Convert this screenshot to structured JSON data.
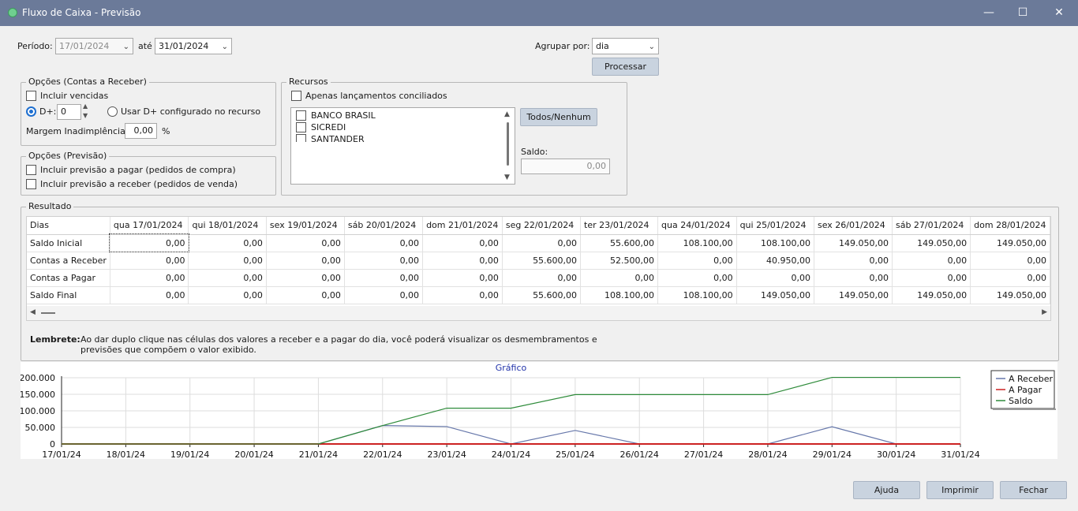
{
  "window": {
    "title": "Fluxo de Caixa - Previsão",
    "minimize": "—",
    "maximize": "☐",
    "close": "✕"
  },
  "periodo": {
    "label": "Período:",
    "from": "17/01/2024",
    "ate_label": "até",
    "to": "31/01/2024"
  },
  "agrupar": {
    "label": "Agrupar por:",
    "value": "dia"
  },
  "processar_label": "Processar",
  "opcoes_receber": {
    "title": "Opções (Contas a Receber)",
    "incluir_vencidas": "Incluir vencidas",
    "dplus_label": "D+:",
    "dplus_value": "0",
    "usar_dplus": "Usar D+ configurado no recurso",
    "margem_label": "Margem Inadimplência:",
    "margem_value": "0,00",
    "margem_unit": "%"
  },
  "opcoes_previsao": {
    "title": "Opções (Previsão)",
    "pagar": "Incluir previsão a pagar (pedidos de compra)",
    "receber": "Incluir previsão a receber (pedidos de venda)"
  },
  "recursos": {
    "title": "Recursos",
    "apenas_conciliados": "Apenas lançamentos conciliados",
    "items": [
      "BANCO BRASIL",
      "SICREDI",
      "SANTANDER"
    ],
    "todos_label": "Todos/Nenhum",
    "saldo_label": "Saldo:",
    "saldo_value": "0,00"
  },
  "resultado": {
    "title": "Resultado",
    "header_first": "Dias",
    "days": [
      "qua 17/01/2024",
      "qui 18/01/2024",
      "sex 19/01/2024",
      "sáb 20/01/2024",
      "dom 21/01/2024",
      "seg 22/01/2024",
      "ter 23/01/2024",
      "qua 24/01/2024",
      "qui 25/01/2024",
      "sex 26/01/2024",
      "sáb 27/01/2024",
      "dom 28/01/2024"
    ],
    "rows": [
      {
        "label": "Saldo Inicial",
        "values": [
          "0,00",
          "0,00",
          "0,00",
          "0,00",
          "0,00",
          "0,00",
          "55.600,00",
          "108.100,00",
          "108.100,00",
          "149.050,00",
          "149.050,00",
          "149.050,00"
        ]
      },
      {
        "label": "Contas a Receber",
        "values": [
          "0,00",
          "0,00",
          "0,00",
          "0,00",
          "0,00",
          "55.600,00",
          "52.500,00",
          "0,00",
          "40.950,00",
          "0,00",
          "0,00",
          "0,00"
        ]
      },
      {
        "label": "Contas a Pagar",
        "values": [
          "0,00",
          "0,00",
          "0,00",
          "0,00",
          "0,00",
          "0,00",
          "0,00",
          "0,00",
          "0,00",
          "0,00",
          "0,00",
          "0,00"
        ]
      },
      {
        "label": "Saldo Final",
        "values": [
          "0,00",
          "0,00",
          "0,00",
          "0,00",
          "0,00",
          "55.600,00",
          "108.100,00",
          "108.100,00",
          "149.050,00",
          "149.050,00",
          "149.050,00",
          "149.050,00"
        ]
      }
    ]
  },
  "lembrete": {
    "label": "Lembrete:",
    "line1": "Ao dar duplo clique nas células dos valores a receber e a pagar do dia, você poderá visualizar os desmembramentos e",
    "line2": "previsões que compõem o valor exibido."
  },
  "chart_data": {
    "type": "line",
    "title": "Gráfico",
    "x": [
      "17/01/24",
      "18/01/24",
      "19/01/24",
      "20/01/24",
      "21/01/24",
      "22/01/24",
      "23/01/24",
      "24/01/24",
      "25/01/24",
      "26/01/24",
      "27/01/24",
      "28/01/24",
      "29/01/24",
      "30/01/24",
      "31/01/24"
    ],
    "yticks": [
      "200.000",
      "150.000",
      "100.000",
      "50.000",
      "0"
    ],
    "ylim": [
      0,
      200000
    ],
    "grid": true,
    "legend_position": "right",
    "series": [
      {
        "name": "A Receber",
        "color": "#6677aa",
        "values": [
          0,
          0,
          0,
          0,
          0,
          55600,
          52500,
          0,
          40950,
          0,
          0,
          0,
          52000,
          0,
          0
        ]
      },
      {
        "name": "A Pagar",
        "color": "#cc2222",
        "values": [
          0,
          0,
          0,
          0,
          0,
          0,
          0,
          0,
          0,
          0,
          0,
          0,
          0,
          0,
          0
        ]
      },
      {
        "name": "Saldo",
        "color": "#2e8b3a",
        "values": [
          0,
          0,
          0,
          0,
          0,
          55600,
          108100,
          108100,
          149050,
          149050,
          149050,
          149050,
          201050,
          201050,
          201050
        ]
      }
    ]
  },
  "footer": {
    "ajuda": "Ajuda",
    "imprimir": "Imprimir",
    "fechar": "Fechar"
  }
}
